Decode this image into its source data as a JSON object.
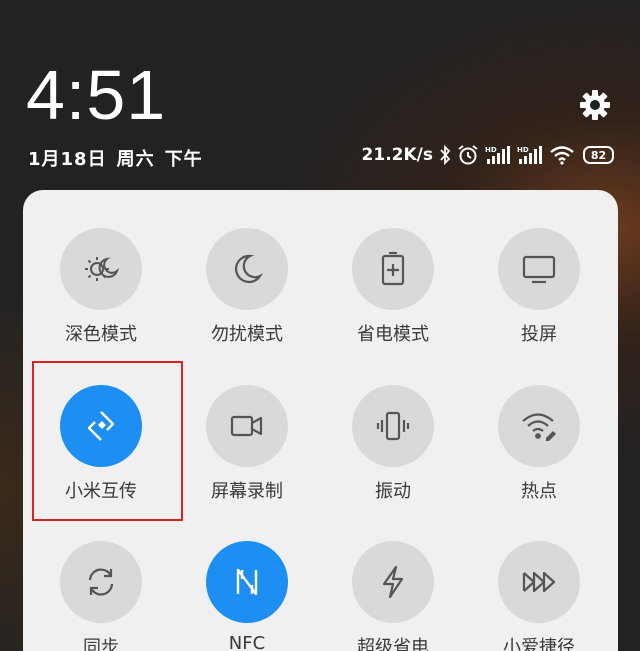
{
  "lockscreen": {
    "time": "4:51",
    "date": "1月18日",
    "weekday": "周六",
    "period": "下午"
  },
  "status": {
    "net_speed": "21.2K/s",
    "icons": [
      "bluetooth-icon",
      "alarm-icon",
      "hd-signal-icon",
      "hd-signal-icon",
      "wifi-icon"
    ],
    "battery": "82"
  },
  "tiles": [
    {
      "label": "深色模式",
      "icon": "dark-mode-icon",
      "active": false
    },
    {
      "label": "勿扰模式",
      "icon": "moon-icon",
      "active": false
    },
    {
      "label": "省电模式",
      "icon": "battery-saver-icon",
      "active": false
    },
    {
      "label": "投屏",
      "icon": "cast-screen-icon",
      "active": false
    },
    {
      "label": "小米互传",
      "icon": "mi-share-icon",
      "active": true
    },
    {
      "label": "屏幕录制",
      "icon": "video-camera-icon",
      "active": false
    },
    {
      "label": "振动",
      "icon": "vibrate-icon",
      "active": false
    },
    {
      "label": "热点",
      "icon": "hotspot-icon",
      "active": false
    },
    {
      "label": "同步",
      "icon": "sync-icon",
      "active": false
    },
    {
      "label": "NFC",
      "icon": "nfc-icon",
      "active": true
    },
    {
      "label": "超级省电",
      "icon": "lightning-icon",
      "active": false
    },
    {
      "label": "小爱捷径",
      "icon": "shortcut-icon",
      "active": false
    }
  ],
  "colors": {
    "active": "#1e8ff2",
    "inactive": "#d9d9d9",
    "panel": "#f0f0f0",
    "highlight": "#dd2222"
  }
}
